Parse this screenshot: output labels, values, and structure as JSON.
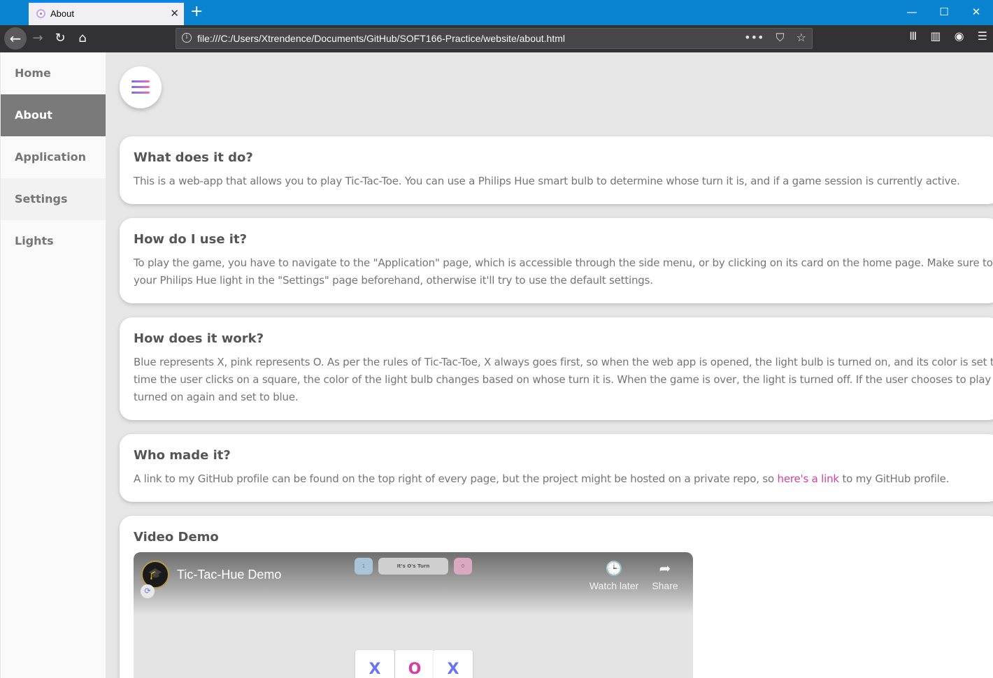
{
  "browser": {
    "tab_title": "About",
    "tab_close": "✕",
    "new_tab": "+",
    "url": "file:///C:/Users/Xtrendence/Documents/GitHub/SOFT166-Practice/website/about.html",
    "window_controls": {
      "minimize": "—",
      "maximize": "☐",
      "close": "✕"
    },
    "nav": {
      "back": "←",
      "forward": "→",
      "reload": "↻",
      "home": "⌂"
    },
    "url_actions": {
      "more": "•••",
      "pocket": "⛉",
      "bookmark": "☆"
    },
    "toolbar": {
      "library": "Ⅲ",
      "sidebar": "▥",
      "account": "◉",
      "menu": "☰"
    },
    "info_icon": "i"
  },
  "sidebar": {
    "items": [
      {
        "label": "Home"
      },
      {
        "label": "About"
      },
      {
        "label": "Application"
      },
      {
        "label": "Settings"
      },
      {
        "label": "Lights"
      }
    ]
  },
  "cards": [
    {
      "title": "What does it do?",
      "lines": [
        "This is a web-app that allows you to play Tic-Tac-Toe. You can use a Philips Hue smart bulb to determine whose turn it is, and if a game session is currently active."
      ]
    },
    {
      "title": "How do I use it?",
      "lines": [
        "To play the game, you have to navigate to the \"Application\" page, which is accessible through the side menu, or by clicking on its card on the home page. Make sure to set the",
        "your Philips Hue light in the \"Settings\" page beforehand, otherwise it'll try to use the default settings."
      ]
    },
    {
      "title": "How does it work?",
      "lines": [
        "Blue represents X, pink represents O. As per the rules of Tic-Tac-Toe, X always goes first, so when the web app is opened, the light bulb is turned on, and its color is set to b",
        "time the user clicks on a square, the color of the light bulb changes based on whose turn it is. When the game is over, the light is turned off. If the user chooses to play again",
        "turned on again and set to blue."
      ]
    },
    {
      "title": "Who made it?",
      "text_before": "A link to my GitHub profile can be found on the top right of every page, but the project might be hosted on a private repo, so ",
      "link": "here's a link",
      "text_after": " to my GitHub profile."
    },
    {
      "title": "Video Demo"
    }
  ],
  "video": {
    "title": "Tic-Tac-Hue Demo",
    "watch_later": "Watch later",
    "share": "Share",
    "turn_label": "It's O's Turn",
    "score_x": "1",
    "score_o": "0",
    "board_row": [
      "X",
      "O",
      "X"
    ],
    "avatar_icon": "🎓",
    "clock_icon": "🕒",
    "share_icon": "➦",
    "sync_icon": "⟳"
  },
  "colors": {
    "x_blue": "#6a73f0",
    "o_pink": "#d63fa0",
    "link": "#d63fa0",
    "sidebar_active": "#7a7a7a"
  }
}
